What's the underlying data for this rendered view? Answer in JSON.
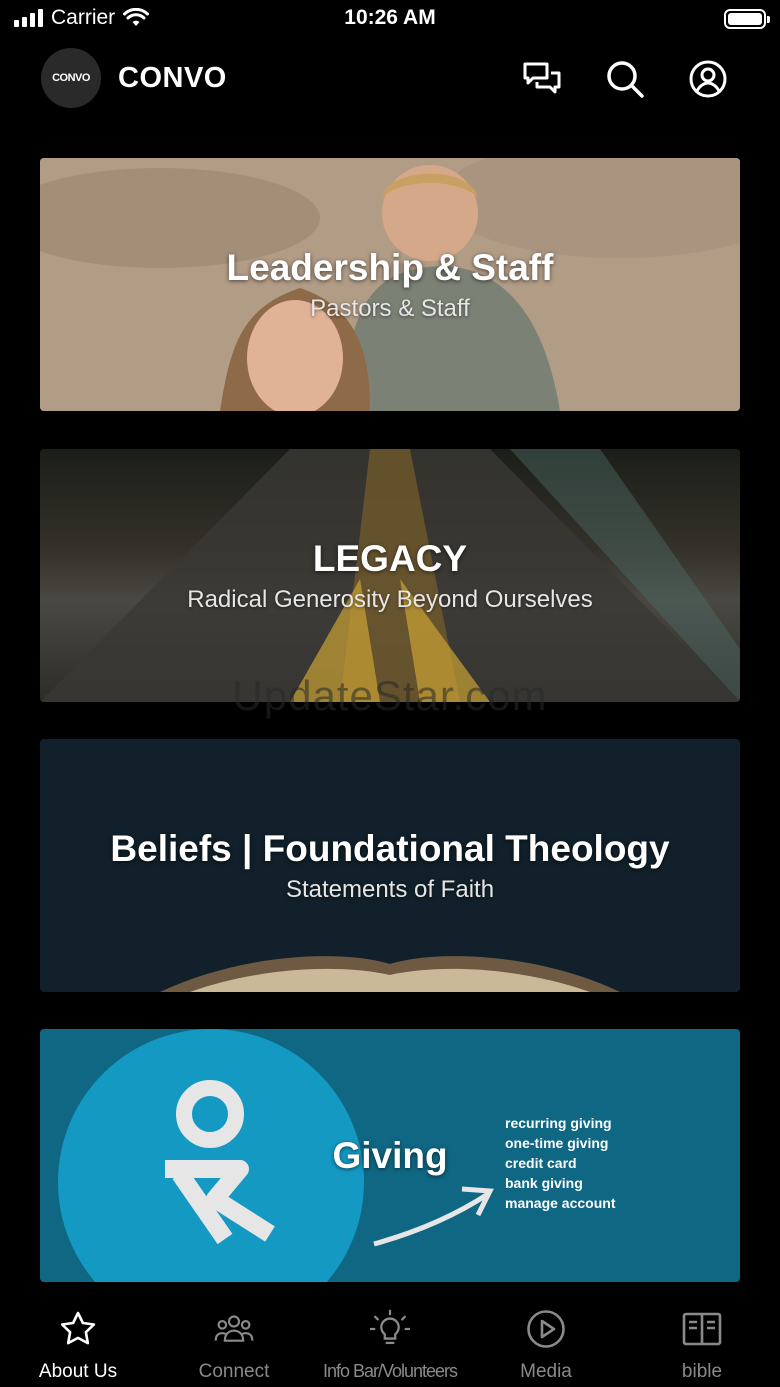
{
  "status_bar": {
    "carrier": "Carrier",
    "time": "10:26 AM"
  },
  "header": {
    "logo_text": "CONVO",
    "title": "CONVO",
    "icons": [
      "chat-icon",
      "search-icon",
      "profile-icon"
    ]
  },
  "cards": [
    {
      "title": "Leadership & Staff",
      "subtitle": "Pastors & Staff"
    },
    {
      "title": "LEGACY",
      "subtitle": "Radical Generosity Beyond Ourselves"
    },
    {
      "title": "Beliefs | Foundational Theology",
      "subtitle": "Statements of Faith"
    },
    {
      "title": "Giving",
      "options": [
        "recurring giving",
        "one-time giving",
        "credit card",
        "bank giving",
        "manage account"
      ]
    }
  ],
  "watermark": "UpdateStar.com",
  "tabs": [
    {
      "label": "About Us",
      "icon": "star-icon",
      "active": true
    },
    {
      "label": "Connect",
      "icon": "group-icon",
      "active": false
    },
    {
      "label": "Info Bar/Volunteers",
      "icon": "lightbulb-icon",
      "active": false
    },
    {
      "label": "Media",
      "icon": "play-icon",
      "active": false
    },
    {
      "label": "bible",
      "icon": "book-icon",
      "active": false
    }
  ],
  "colors": {
    "background": "#000000",
    "active_tab": "#ffffff",
    "inactive_tab": "#8a8a8a",
    "giving_card": "#0f6784",
    "giving_circle": "#1499c3"
  }
}
